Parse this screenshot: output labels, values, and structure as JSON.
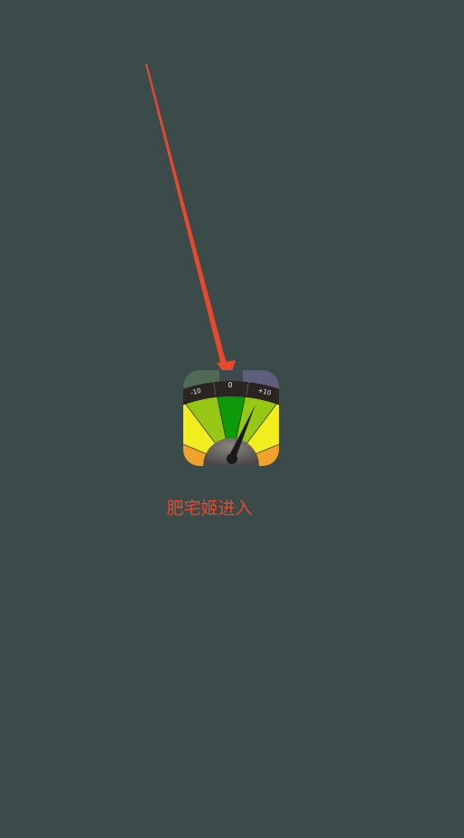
{
  "colors": {
    "background": "#3b4b4a",
    "annotation_arrow": "#e8492d",
    "label_text": "#e8492d"
  },
  "app": {
    "label": "肥宅姬进入",
    "icon_name": "gauge-meter-icon",
    "icon_scale_labels": [
      "-10",
      "0",
      "+10"
    ]
  },
  "annotation": {
    "icon_name": "red-arrow-annotation-icon"
  }
}
